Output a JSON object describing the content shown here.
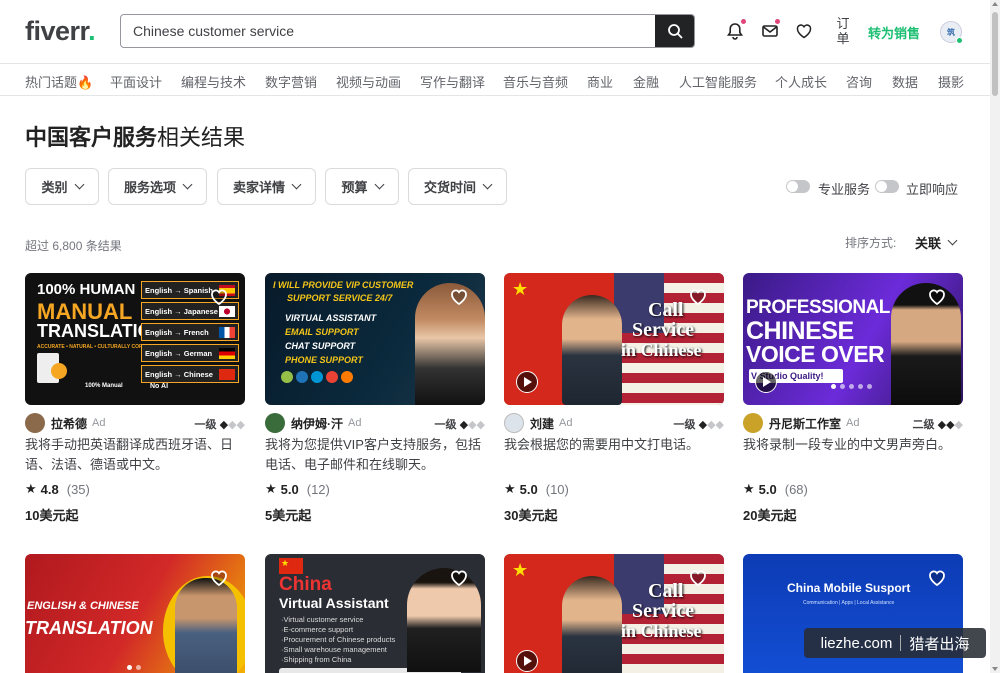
{
  "header": {
    "logo_text": "fiverr",
    "logo_dot": ".",
    "search_value": "Chinese customer service",
    "orders_label": "订单",
    "become_seller": "转为销售",
    "avatar_text": "筑"
  },
  "categories": [
    "热门话题🔥",
    "平面设计",
    "编程与技术",
    "数字营销",
    "视频与动画",
    "写作与翻译",
    "音乐与音频",
    "商业",
    "金融",
    "人工智能服务",
    "个人成长",
    "咨询",
    "数据",
    "摄影"
  ],
  "page": {
    "title_bold": "中国客户服务",
    "title_rest": "相关结果",
    "result_count": "超过 6,800 条结果",
    "sort_label": "排序方式:",
    "sort_value": "关联"
  },
  "filters": [
    "类别",
    "服务选项",
    "卖家详情",
    "预算",
    "交货时间"
  ],
  "toggles": [
    "专业服务",
    "立即响应"
  ],
  "gigs": [
    {
      "seller": "拉希德",
      "ad": "Ad",
      "level": "一级",
      "diamonds_on": 1,
      "title": "我将手动把英语翻译成西班牙语、日语、法语、德语或中文。",
      "score": "4.8",
      "reviews": "(35)",
      "price": "10美元起"
    },
    {
      "seller": "纳伊姆·汗",
      "ad": "Ad",
      "level": "一级",
      "diamonds_on": 1,
      "title": "我将为您提供VIP客户支持服务，包括电话、电子邮件和在线聊天。",
      "score": "5.0",
      "reviews": "(12)",
      "price": "5美元起"
    },
    {
      "seller": "刘建",
      "ad": "Ad",
      "level": "一级",
      "diamonds_on": 1,
      "title": "我会根据您的需要用中文打电话。",
      "score": "5.0",
      "reviews": "(10)",
      "price": "30美元起"
    },
    {
      "seller": "丹尼斯工作室",
      "ad": "Ad",
      "level": "二级",
      "diamonds_on": 2,
      "title": "我将录制一段专业的中文男声旁白。",
      "score": "5.0",
      "reviews": "(68)",
      "price": "20美元起"
    }
  ],
  "thumb_text": {
    "t1": {
      "l1": "100% HUMAN",
      "l2": "MANUAL",
      "l3": "TRANSLATION",
      "l4": "ACCURATE • NATURAL • CULTURALLY CORRECT",
      "langs": [
        "English → Spanish",
        "English → Japanese",
        "English → French",
        "English → German",
        "English → Chinese"
      ],
      "b1": "100% Manual",
      "b2": "No AI"
    },
    "t2": {
      "l1": "I WILL PROVIDE VIP CUSTOMER",
      "l2": "SUPPORT SERVICE 24/7",
      "items": [
        "VIRTUAL ASSISTANT",
        "EMAIL SUPPORT",
        "CHAT SUPPORT",
        "PHONE SUPPORT"
      ]
    },
    "t3": {
      "l1": "Call",
      "l2": "Service",
      "l3": "in Chinese"
    },
    "t4": {
      "l1": "PROFESSIONAL",
      "l2": "CHINESE",
      "l3": "VOICE OVER",
      "l4": "V Studio Quality!"
    },
    "t5": {
      "l1": "ENGLISH & CHINESE",
      "l2": "TRANSLATION"
    },
    "t6": {
      "l1": "China",
      "l2": "Virtual Assistant",
      "items": [
        "·Virtual customer service",
        "·E-commerce support",
        "·Procurement of Chinese products",
        "·Small warehouse management",
        "·Shipping from China"
      ]
    },
    "t7": {
      "l1": "Call",
      "l2": "Service",
      "l3": "in Chinese"
    },
    "t8": {
      "l1": "China Mobile Susport",
      "l2": "Communication | Apps | Local Assistance"
    }
  },
  "watermark": {
    "left": "liezhe.com",
    "right": "猎者出海"
  },
  "colors": {
    "brand_green": "#1dbf73",
    "dark": "#222325"
  }
}
